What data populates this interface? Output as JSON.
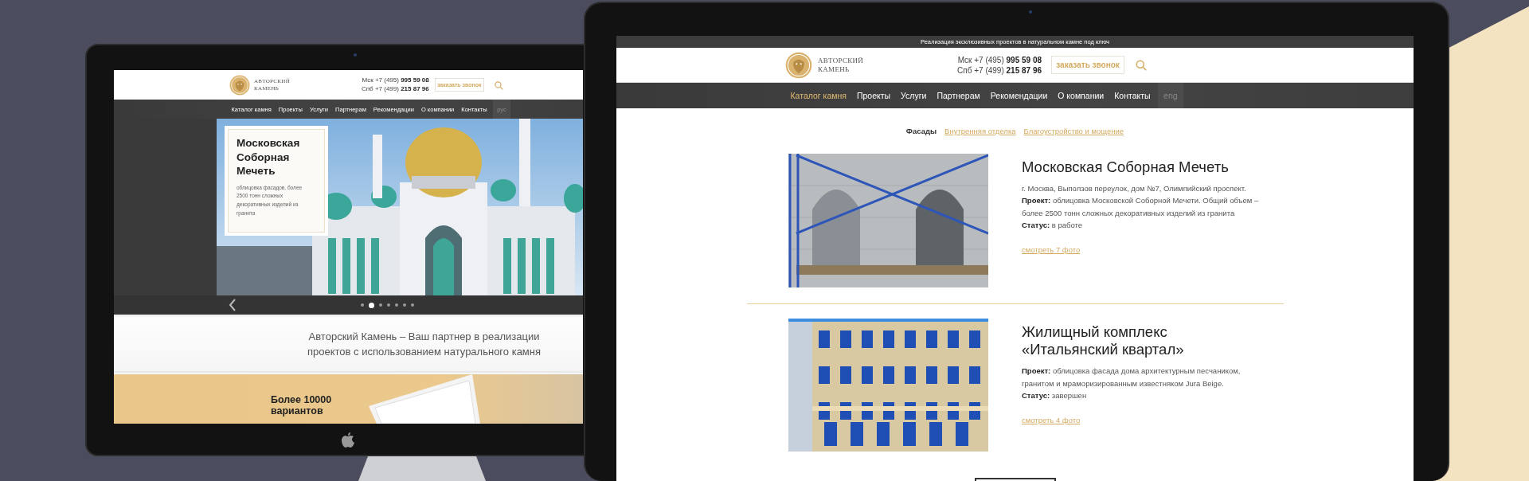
{
  "left_screen": {
    "header": {
      "logo_lines": [
        "АВТОРСКИЙ",
        "КАМЕНЬ"
      ],
      "phones": [
        "Мск +7 (495) **995 59 08**",
        "Спб +7 (499) **215 87 96**"
      ],
      "callback_button": "заказать звонок"
    },
    "nav": [
      {
        "label": "Каталог камня",
        "selected": false
      },
      {
        "label": "Проекты",
        "selected": false
      },
      {
        "label": "Услуги",
        "selected": false
      },
      {
        "label": "Партнерам",
        "selected": false
      },
      {
        "label": "Рекомендации",
        "selected": false
      },
      {
        "label": "О компании",
        "selected": false
      },
      {
        "label": "Контакты",
        "selected": false
      }
    ],
    "language": {
      "label": "рус",
      "selected": false
    },
    "slide": {
      "title": "Московская Соборная Мечеть",
      "text": "облицовка фасадов, более 2500 тонн сложных декоративных изделий из гранита"
    },
    "slider_dots": [
      {
        "selected": false
      },
      {
        "selected": true
      },
      {
        "selected": false
      },
      {
        "selected": false
      },
      {
        "selected": false
      },
      {
        "selected": false
      },
      {
        "selected": false
      }
    ],
    "intro": "Авторский Камень – Ваш партнер в реализации проектов с использованием натурального камня",
    "promo": "Более 10000 вариантов"
  },
  "right_screen": {
    "top_strip": "Реализация эксклюзивных проектов в натуральном камне под ключ",
    "header": {
      "logo_lines": [
        "АВТОРСКИЙ",
        "КАМЕНЬ"
      ],
      "phones": [
        "Мск +7 (495) **995 59 08**",
        "Спб +7 (499) **215 87 96**"
      ],
      "callback_button": "заказать звонок"
    },
    "nav": [
      {
        "label": "Каталог камня",
        "selected": true
      },
      {
        "label": "Проекты",
        "selected": false
      },
      {
        "label": "Услуги",
        "selected": false
      },
      {
        "label": "Партнерам",
        "selected": false
      },
      {
        "label": "Рекомендации",
        "selected": false
      },
      {
        "label": "О компании",
        "selected": false
      },
      {
        "label": "Контакты",
        "selected": false
      }
    ],
    "language": {
      "label": "eng",
      "selected": false
    },
    "categories": [
      {
        "label": "Фасады",
        "selected": true
      },
      {
        "label": "Внутренняя отделка",
        "selected": false
      },
      {
        "label": "Благоустройство и мощение",
        "selected": false
      }
    ],
    "projects": [
      {
        "kind": "stone",
        "title": "Московская Соборная Мечеть",
        "address": "г. Москва, Выползов переулок, дом №7, Олимпийский проспект.",
        "project": "**Проект:** облицовка Московской Соборной Мечети. Общий объем – более 2500 тонн сложных декоративных изделий из гранита",
        "status": "**Статус:** в работе",
        "link": "смотреть 7 фото"
      },
      {
        "kind": "building",
        "title": "Жилищный комплекс «Итальянский квартал»",
        "project": "**Проект:** облицовка фасада дома архитектурным песчаником, гранитом и мраморизированным известняком Jura Beige.",
        "status": "**Статус:** завершен",
        "link": "смотреть 4 фото"
      }
    ]
  }
}
